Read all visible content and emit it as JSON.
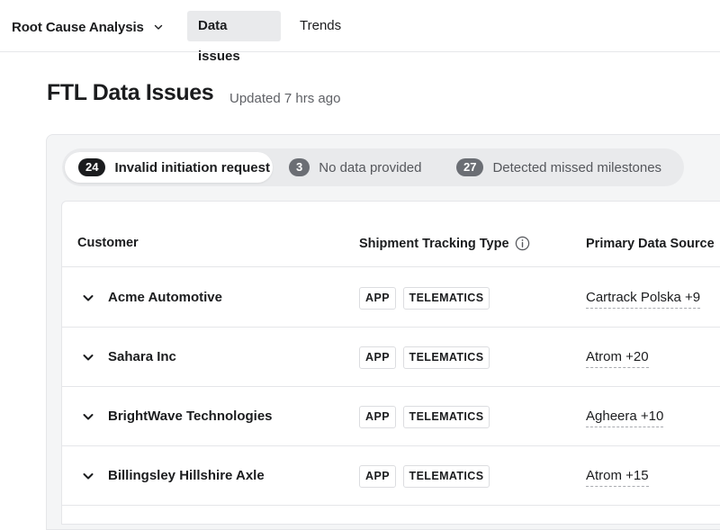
{
  "nav": {
    "app_switcher_label": "Root Cause Analysis",
    "tabs": [
      {
        "label": "Data issues",
        "active": true
      },
      {
        "label": "Trends",
        "active": false
      }
    ]
  },
  "header": {
    "title": "FTL Data Issues",
    "updated": "Updated 7 hrs ago"
  },
  "filters": [
    {
      "count": "24",
      "label": "Invalid initiation request",
      "active": true
    },
    {
      "count": "3",
      "label": "No data provided",
      "active": false
    },
    {
      "count": "27",
      "label": "Detected missed milestones",
      "active": false
    }
  ],
  "table": {
    "columns": {
      "customer": "Customer",
      "tracking_type": "Shipment Tracking Type",
      "primary_source": "Primary Data Source"
    },
    "rows": [
      {
        "customer": "Acme Automotive",
        "tags": [
          "APP",
          "TELEMATICS"
        ],
        "source": "Cartrack Polska +9"
      },
      {
        "customer": "Sahara Inc",
        "tags": [
          "APP",
          "TELEMATICS"
        ],
        "source": "Atrom +20"
      },
      {
        "customer": "BrightWave Technologies",
        "tags": [
          "APP",
          "TELEMATICS"
        ],
        "source": "Agheera +10"
      },
      {
        "customer": "Billingsley Hillshire Axle",
        "tags": [
          "APP",
          "TELEMATICS"
        ],
        "source": "Atrom +15"
      }
    ]
  },
  "icons": {
    "app_switcher": "chevron-down-icon",
    "column_info": "info-icon",
    "row_expand": "chevron-down-icon"
  },
  "colors": {
    "active_count_badge": "#1b1c1e",
    "inactive_count_badge": "#6b6e74",
    "active_tab_bg": "#e9eaec"
  }
}
